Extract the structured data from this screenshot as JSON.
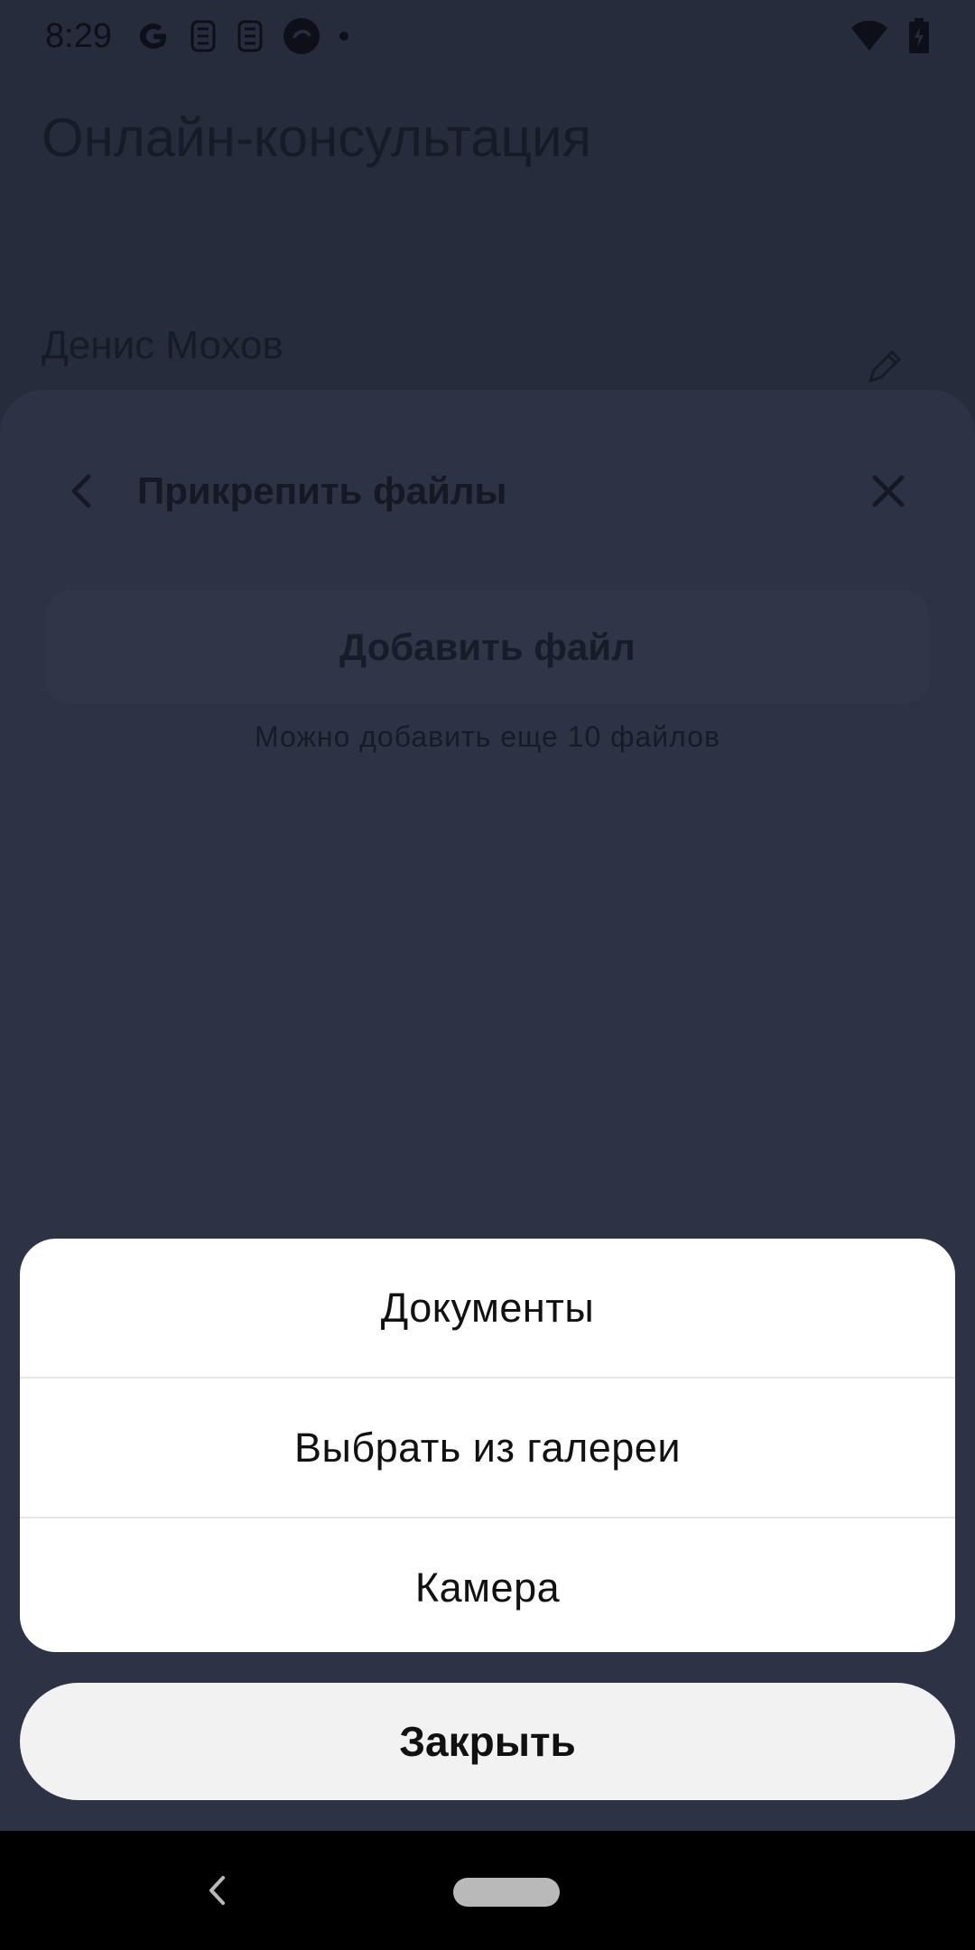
{
  "status_bar": {
    "time": "8:29",
    "left_icons": [
      "google-icon",
      "notification-icon",
      "notification-icon",
      "app-icon",
      "dot-icon"
    ],
    "right_icons": [
      "wifi-icon",
      "battery-charging-icon"
    ]
  },
  "background_page": {
    "title": "Онлайн-консультация",
    "patient_name": "Денис Мохов"
  },
  "attach_sheet": {
    "title": "Прикрепить файлы",
    "add_file_label": "Добавить файл",
    "hint": "Можно добавить еще 10 файлов"
  },
  "action_sheet": {
    "items": [
      {
        "label": "Документы"
      },
      {
        "label": "Выбрать из галереи"
      },
      {
        "label": "Камера"
      }
    ],
    "close_label": "Закрыть"
  },
  "colors": {
    "overlay": "#262c3c",
    "sheet": "#ffffff",
    "close_button": "#f2f2f2"
  }
}
